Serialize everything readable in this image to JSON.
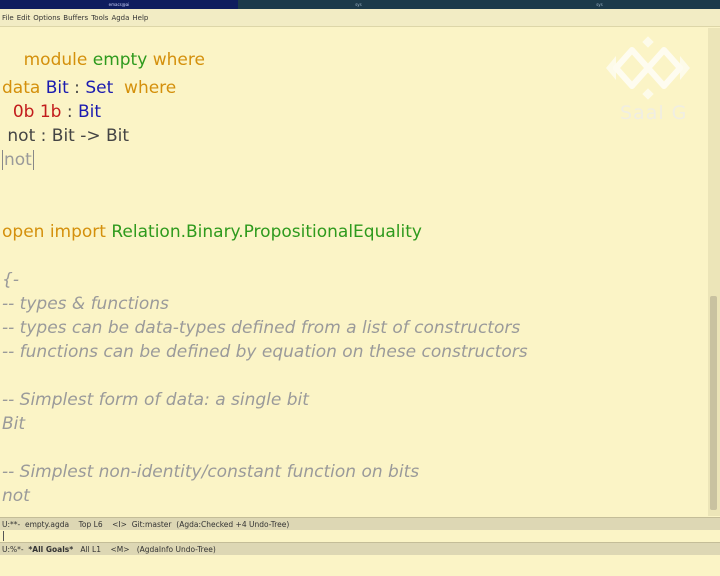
{
  "topbar": {
    "left": "emacs@ai",
    "middle": "sys",
    "right": "sys"
  },
  "menubar": {
    "items": [
      "File",
      "Edit",
      "Options",
      "Buffers",
      "Tools",
      "Agda",
      "Help"
    ]
  },
  "code": {
    "l1": {
      "kw1": "module",
      "name": "empty",
      "kw2": "where"
    },
    "l3": {
      "kw1": "data",
      "type": "Bit",
      "colon": " : ",
      "set": "Set",
      "kw2": "where"
    },
    "l4": {
      "c0": "0b",
      "c1": "1b",
      "colon": " : ",
      "type": "Bit"
    },
    "l5": {
      "text": "not : Bit -> Bit"
    },
    "l6": {
      "goal": "not"
    },
    "l9": {
      "kw": "open import",
      "module": "Relation.Binary.PropositionalEquality"
    },
    "comments": [
      "{-",
      "-- types & functions",
      "-- types can be data-types defined from a list of constructors",
      "-- functions can be defined by equation on these constructors",
      "",
      "-- Simplest form of data: a single bit",
      "Bit",
      "",
      "-- Simplest non-identity/constant function on bits",
      "not"
    ]
  },
  "logo": {
    "text": "Saal G"
  },
  "modeline1": "U:**-  empty.agda    Top L6    <I>  Git:master  (Agda:Checked +4 Undo-Tree)",
  "modeline2": {
    "prefix": "U:%*-  ",
    "buffer": "*All Goals*",
    "rest": "   All L1    <M>   (AgdaInfo Undo-Tree)"
  },
  "colors": {
    "background": "#fbf4c6",
    "keyword": "#d4900c",
    "module": "#2e9a1d",
    "type": "#1b1bb0",
    "constructor": "#c21c1c",
    "comment": "#9a9a9a"
  }
}
